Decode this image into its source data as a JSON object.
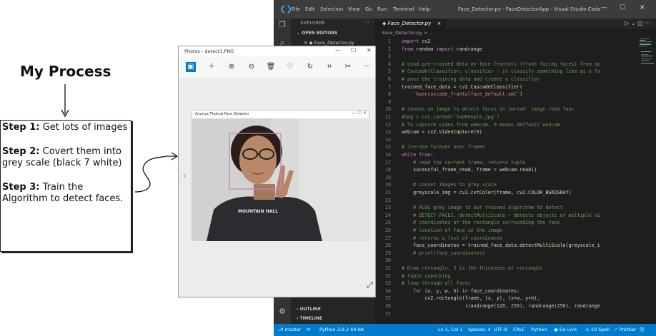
{
  "slide": {
    "title": "My Process",
    "steps": [
      {
        "label": "Step 1:",
        "text": " Get lots of images"
      },
      {
        "label": "Step 2:",
        "text": " Covert them into grey scale (black 7 white)"
      },
      {
        "label": "Step 3:",
        "text": "  Train the Algorithm to detect faces."
      }
    ]
  },
  "vscode": {
    "menu": [
      "File",
      "Edit",
      "Selection",
      "View",
      "Go",
      "Run",
      "Terminal",
      "Help"
    ],
    "window_title": "Face_Detector.py - FaceDetectorApp - Visual Studio Code",
    "sidebar": {
      "header": "EXPLORER",
      "open_editors": "OPEN EDITORS",
      "open_file": "Face_Detector.py",
      "outline": "OUTLINE",
      "timeline": "TIMELINE"
    },
    "tab": "Face_Detector.py",
    "breadcrumb": "Face_Detector.py > ...",
    "code_lines": [
      {
        "n": "1",
        "t": "import cv2"
      },
      {
        "n": "2",
        "t": "from random import randrange"
      },
      {
        "n": "3",
        "t": ""
      },
      {
        "n": "4",
        "t": "# Load pre-trained data on face frontals (front facing faces) from op"
      },
      {
        "n": "5",
        "t": "# Cascade(Classifier: classifier - it classify something like as a fa"
      },
      {
        "n": "6",
        "t": "# pass the training data and create a classifier"
      },
      {
        "n": "7",
        "t": "trained_face_data = cv2.CascadeClassifier("
      },
      {
        "n": "8",
        "t": "    'haarcascade_frontalface_default.xml')"
      },
      {
        "n": "9",
        "t": ""
      },
      {
        "n": "10",
        "t": "# choose an image to detect faces in imread- image read func"
      },
      {
        "n": "11",
        "t": "#img = cv2.imread('TwoPeople.jpg')"
      },
      {
        "n": "12",
        "t": "# To capture video from webcam, 0 means deffault webcam"
      },
      {
        "n": "13",
        "t": "webcam = cv2.VideoCapture(0)"
      },
      {
        "n": "14",
        "t": ""
      },
      {
        "n": "15",
        "t": "# iterate forever over frames"
      },
      {
        "n": "16",
        "t": "while True:"
      },
      {
        "n": "17",
        "t": "    # read the current frame, returns tuple"
      },
      {
        "n": "18",
        "t": "    sucessful_frame_read, frame = webcam.read()"
      },
      {
        "n": "19",
        "t": ""
      },
      {
        "n": "20",
        "t": "    # convet images to grey scale"
      },
      {
        "n": "21",
        "t": "    greyscale_img = cv2.cvtColor(frame, cv2.COLOR_BGR2GRAY)"
      },
      {
        "n": "22",
        "t": ""
      },
      {
        "n": "23",
        "t": "    # PLUG grey image to our trained algorithm to detect"
      },
      {
        "n": "24",
        "t": "    # DETECT FACES, detectMultiScale - detects objects of multiple si"
      },
      {
        "n": "25",
        "t": "    # coordinates of the rectangle surrounding the face"
      },
      {
        "n": "26",
        "t": "    # location of face in the image"
      },
      {
        "n": "27",
        "t": "    # returns a lost of coordinates"
      },
      {
        "n": "28",
        "t": "    face_coordinates = trained_face_data.detectMultiScale(greyscale_i"
      },
      {
        "n": "29",
        "t": "    # print(face_coordinates)"
      },
      {
        "n": "30",
        "t": ""
      },
      {
        "n": "31",
        "t": "# Draw rectangle, 2 is the thickness of rectangle"
      },
      {
        "n": "32",
        "t": "# tuple unpacking"
      },
      {
        "n": "33",
        "t": "# loop through all faces"
      },
      {
        "n": "34",
        "t": "    for (x, y, w, h) in face_coordinates:"
      },
      {
        "n": "35",
        "t": "        cv2.rectangle(frame, (x, y), (x+w, y+h),"
      },
      {
        "n": "36",
        "t": "                      (randrange(128, 256), randrange(256), randrange"
      },
      {
        "n": "37",
        "t": ""
      }
    ],
    "status": {
      "branch": "master",
      "python": "Python 3.9.2 64-bit",
      "position": "Ln 1, Col 1",
      "spaces": "Spaces: 4",
      "encoding": "UTF-8",
      "eol": "CRLF",
      "lang": "Python",
      "golive": "Go Live",
      "spell": "10 Spell",
      "prettier": "Prettier"
    }
  },
  "photos": {
    "title": "Photos - detect1.PNG",
    "inner_title": "Ananya Thukral Face Detector",
    "shirt_text": "MOUNTAIN HALL"
  },
  "colors": {
    "vs_bg": "#1e1e1e",
    "status_bar": "#007acc",
    "keyword": "#c586c0",
    "comment": "#6a9955",
    "string": "#ce9178",
    "function": "#dcdcaa",
    "variable": "#9cdcfe",
    "number": "#b5cea8",
    "face_box": "#d07ad0"
  }
}
